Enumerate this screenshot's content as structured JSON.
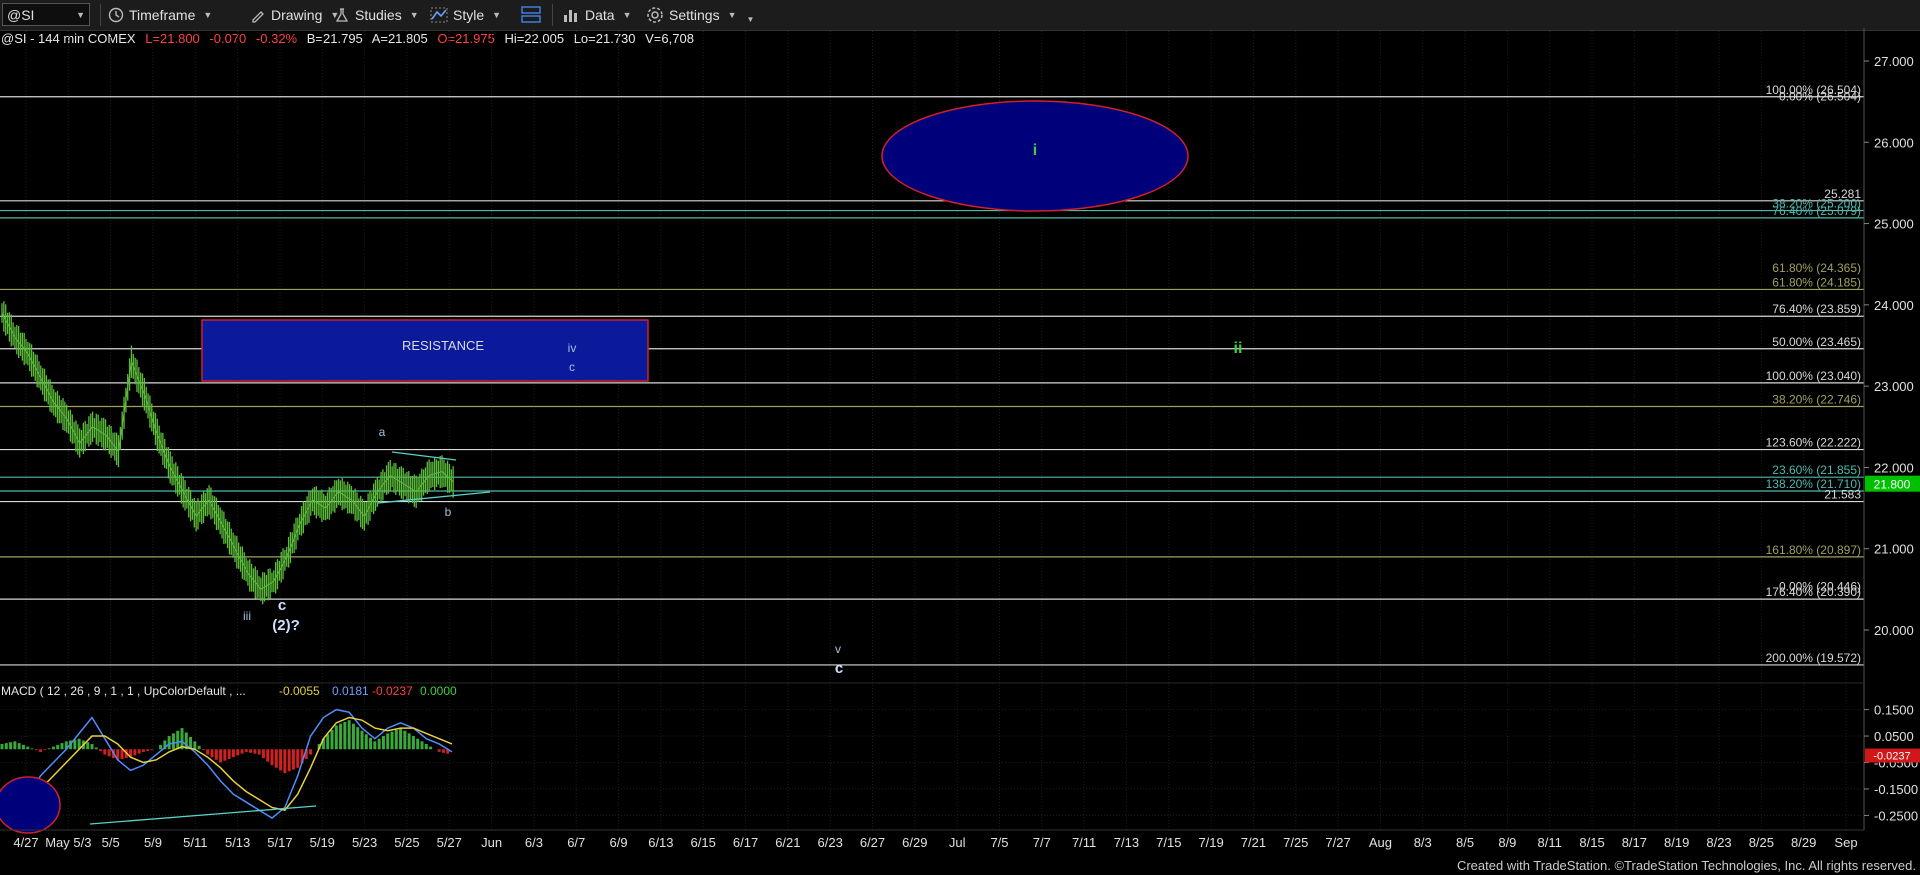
{
  "toolbar": {
    "symbol": "@SI",
    "timeframe": "Timeframe",
    "drawing": "Drawing",
    "studies": "Studies",
    "style": "Style",
    "data": "Data",
    "settings": "Settings"
  },
  "info": {
    "symbol_desc": "@SI - 144 min  COMEX",
    "last": "L=21.800",
    "change": "-0.070",
    "change_pct": "-0.32%",
    "bid": "B=21.795",
    "ask": "A=21.805",
    "open": "O=21.975",
    "high": "Hi=22.005",
    "low": "Lo=21.730",
    "volume": "V=6,708"
  },
  "colors": {
    "up": "#ff3b3b",
    "bar_green": "#5cbd3a",
    "fib_white": "#d8d8d8",
    "fib_teal": "#4fb8b0",
    "fib_olive": "#a0a060",
    "target_fill": "#00007a",
    "target_border": "#d0202a",
    "last_price_bg": "#00c000"
  },
  "chart_data": {
    "type": "line",
    "y_axis": {
      "range": [
        19.35,
        27.35
      ],
      "ticks": [
        "27.000",
        "26.000",
        "25.000",
        "24.000",
        "23.000",
        "22.000",
        "21.000",
        "20.000"
      ],
      "tick_values": [
        27,
        26,
        25,
        24,
        23,
        22,
        21,
        20
      ],
      "last_price": "21.800",
      "last_price_value": 21.8
    },
    "x_axis": {
      "labels": [
        "4/27",
        "May 5/3",
        "5/5",
        "5/9",
        "5/11",
        "5/13",
        "5/17",
        "5/19",
        "5/23",
        "5/25",
        "5/27",
        "Jun",
        "6/3",
        "6/7",
        "6/9",
        "6/13",
        "6/15",
        "6/17",
        "6/21",
        "6/23",
        "6/27",
        "6/29",
        "Jul",
        "7/5",
        "7/7",
        "7/11",
        "7/13",
        "7/15",
        "7/19",
        "7/21",
        "7/25",
        "7/27",
        "Aug",
        "8/3",
        "8/5",
        "8/9",
        "8/11",
        "8/15",
        "8/17",
        "8/19",
        "8/23",
        "8/25",
        "8/29",
        "Sep"
      ]
    },
    "price_series": {
      "name": "@SI",
      "values": [
        23.9,
        23.6,
        23.4,
        23.1,
        22.8,
        22.6,
        22.3,
        22.5,
        22.4,
        22.2,
        23.3,
        22.9,
        22.4,
        22.0,
        21.7,
        21.4,
        21.6,
        21.3,
        21.0,
        20.7,
        20.5,
        20.6,
        20.9,
        21.3,
        21.6,
        21.5,
        21.7,
        21.6,
        21.4,
        21.7,
        21.9,
        21.8,
        21.7,
        21.9,
        21.95,
        21.8
      ]
    },
    "fib_levels": [
      {
        "label": "100.00% (26.504)",
        "value": 26.56,
        "color": "fib_white",
        "line": true
      },
      {
        "label": "0.00% (26.504)",
        "value": 26.48,
        "color": "fib_white",
        "line": false
      },
      {
        "label": "25.281",
        "value": 25.28,
        "color": "fib_white",
        "line": true
      },
      {
        "label": "38.20% (25.200)",
        "value": 25.16,
        "color": "fib_teal",
        "line": true
      },
      {
        "label": "76.40% (25.079)",
        "value": 25.07,
        "color": "fib_teal",
        "line": true
      },
      {
        "label": "61.80% (24.365)",
        "value": 24.37,
        "color": "fib_olive",
        "line": false
      },
      {
        "label": "61.80% (24.185)",
        "value": 24.19,
        "color": "fib_olive",
        "line": true
      },
      {
        "label": "76.40% (23.859)",
        "value": 23.86,
        "color": "fib_white",
        "line": true
      },
      {
        "label": "50.00% (23.465)",
        "value": 23.46,
        "color": "fib_white",
        "line": true
      },
      {
        "label": "100.00% (23.040)",
        "value": 23.04,
        "color": "fib_white",
        "line": true
      },
      {
        "label": "38.20% (22.746)",
        "value": 22.75,
        "color": "fib_olive",
        "line": true
      },
      {
        "label": "123.60% (22.222)",
        "value": 22.22,
        "color": "fib_white",
        "line": true
      },
      {
        "label": "23.60% (21.855)",
        "value": 21.88,
        "color": "fib_teal",
        "line": true
      },
      {
        "label": "138.20% (21.710)",
        "value": 21.71,
        "color": "fib_teal",
        "line": true
      },
      {
        "label": "21.583",
        "value": 21.58,
        "color": "fib_white",
        "line": true
      },
      {
        "label": "161.80% (20.897)",
        "value": 20.9,
        "color": "fib_olive",
        "line": true
      },
      {
        "label": "0.00% (20.446)",
        "value": 20.45,
        "color": "fib_white",
        "line": false
      },
      {
        "label": "176.40% (20.390)",
        "value": 20.38,
        "color": "fib_white",
        "line": true
      },
      {
        "label": "200.00% (19.572)",
        "value": 19.57,
        "color": "fib_white",
        "line": true
      }
    ],
    "annotations": {
      "resistance": "RESISTANCE",
      "wave_i": "i",
      "wave_ii": "ii",
      "wave_iv": "iv",
      "wave_c_upper": "c",
      "wave_a": "a",
      "wave_b": "b",
      "wave_iii": "iii",
      "wave_c_low": "c",
      "wave_2": "(2)?",
      "wave_v": "v",
      "wave_c_target": "c"
    },
    "macd": {
      "label": "MACD ( 12 , 26 , 9 , 1 , 1 , UpColorDefault , ...",
      "v1": "-0.0055",
      "v2": "0.0181",
      "v3": "-0.0237",
      "v4": "0.0000",
      "ticks": [
        "0.1500",
        "0.0500",
        "-0.0500",
        "-0.1500",
        "-0.2500"
      ],
      "tick_values": [
        0.15,
        0.05,
        -0.05,
        -0.15,
        -0.25
      ],
      "last": "-0.0237",
      "last_value": -0.0237,
      "range": [
        -0.29,
        0.19
      ],
      "hist": [
        0.02,
        0.03,
        0.01,
        -0.01,
        0.01,
        0.03,
        0.04,
        0.02,
        -0.02,
        -0.04,
        -0.03,
        -0.01,
        0.0,
        0.05,
        0.08,
        0.03,
        -0.02,
        -0.05,
        -0.03,
        -0.01,
        -0.02,
        -0.06,
        -0.09,
        -0.07,
        -0.02,
        0.04,
        0.09,
        0.11,
        0.07,
        0.03,
        0.06,
        0.08,
        0.05,
        0.02,
        -0.01,
        -0.02
      ],
      "macd_line": [
        -0.21,
        -0.24,
        -0.18,
        -0.1,
        -0.05,
        0.0,
        0.06,
        0.12,
        0.04,
        -0.04,
        -0.08,
        -0.06,
        -0.02,
        0.02,
        0.03,
        -0.01,
        -0.06,
        -0.12,
        -0.17,
        -0.2,
        -0.23,
        -0.26,
        -0.22,
        -0.1,
        0.05,
        0.12,
        0.15,
        0.14,
        0.08,
        0.04,
        0.08,
        0.1,
        0.08,
        0.04,
        0.02,
        -0.01
      ],
      "signal_line": [
        -0.18,
        -0.2,
        -0.2,
        -0.15,
        -0.1,
        -0.05,
        0.0,
        0.05,
        0.05,
        0.02,
        -0.03,
        -0.05,
        -0.04,
        -0.01,
        0.01,
        0.0,
        -0.03,
        -0.07,
        -0.12,
        -0.16,
        -0.19,
        -0.22,
        -0.23,
        -0.17,
        -0.07,
        0.04,
        0.1,
        0.12,
        0.11,
        0.08,
        0.07,
        0.08,
        0.08,
        0.06,
        0.04,
        0.02
      ]
    }
  },
  "footer": "Created with TradeStation. ©TradeStation Technologies, Inc. All rights reserved."
}
